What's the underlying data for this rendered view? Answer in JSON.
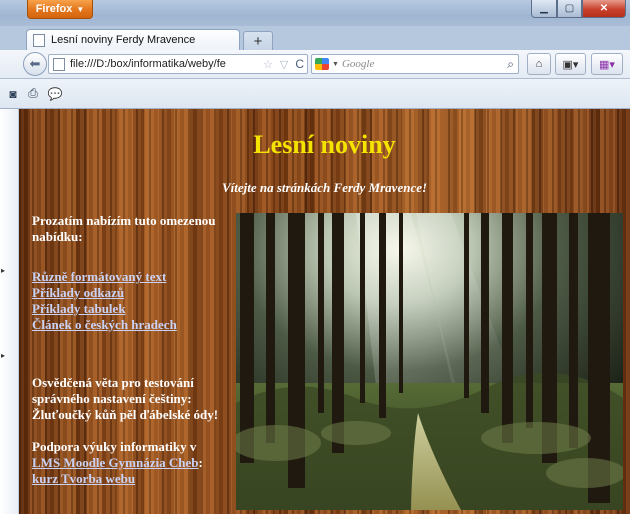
{
  "browser": {
    "menu_button_label": "Firefox",
    "tab_title": "Lesní noviny Ferdy Mravence",
    "url": "file:///D:/box/informatika/weby/fe",
    "search_placeholder": "Google"
  },
  "page": {
    "title": "Lesní noviny",
    "welcome": "Vítejte na stránkách Ferdy Mravence!",
    "intro": "Prozatím nabízím tuto omezenou nabídku:",
    "links": [
      "Různě formátovaný text",
      "Příklady odkazů",
      "Příklady tabulek",
      "Článek o českých hradech"
    ],
    "pangram_intro": "Osvědčená věta pro testování správného nastavení češtiny:",
    "pangram": "Žluťoučký kůň pěl ďábelské ódy!",
    "support_text": "Podpora výuky informatiky v",
    "support_link": "LMS Moodle Gymnázia Cheb",
    "support_colon": ":",
    "course_link": "kurz Tvorba webu"
  },
  "colors": {
    "title": "#f5e400",
    "link": "#c9d2f5",
    "text": "#ffffff",
    "firefox_button": "#e4761c"
  }
}
